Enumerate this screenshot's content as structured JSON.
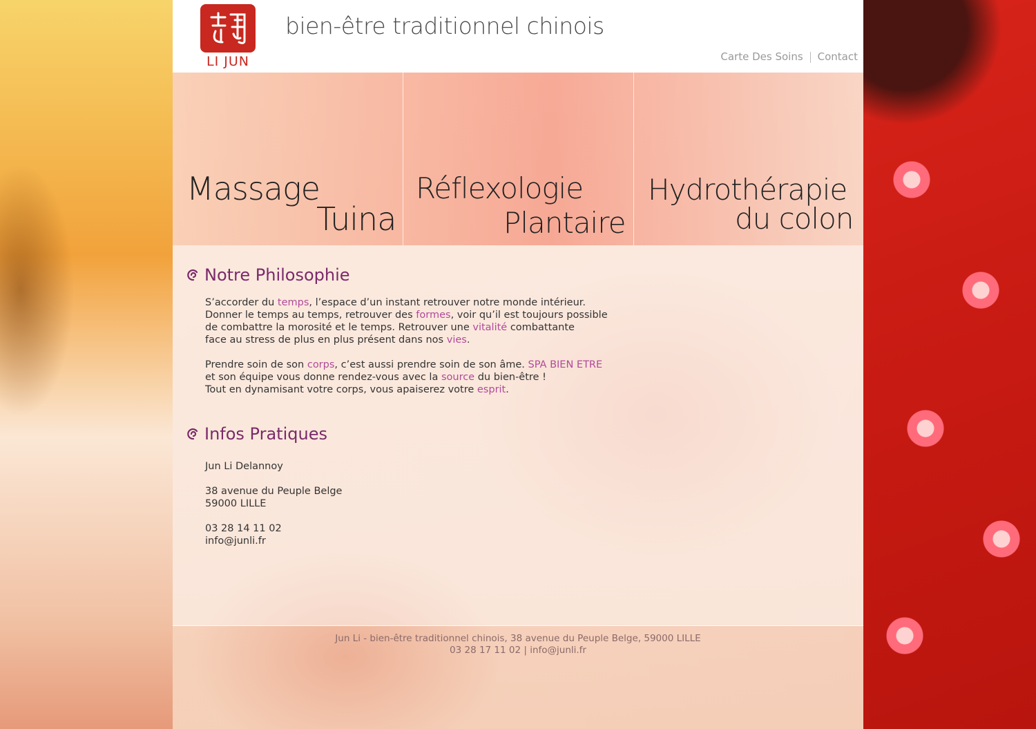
{
  "brand": {
    "logo_text": "LI JUN",
    "tagline": "bien-être traditionnel chinois",
    "accent_color": "#c8281f"
  },
  "topnav": {
    "items": [
      "Carte Des Soins",
      "Contact"
    ]
  },
  "services": [
    {
      "line1": "Massage",
      "line2": "Tuina"
    },
    {
      "line1": "Réflexologie",
      "line2": "Plantaire"
    },
    {
      "line1": "Hydrothérapie",
      "line2": "du colon"
    }
  ],
  "philosophy": {
    "title": "Notre Philosophie",
    "p1": {
      "a": "S’accorder du ",
      "b": "temps",
      "c": ", l’espace d’un instant retrouver notre monde intérieur.",
      "d": "Donner le temps au temps, retrouver des ",
      "e": "formes",
      "f": ", voir qu’il est toujours possible",
      "g": "de combattre la morosité et le temps. Retrouver une ",
      "h": "vitalité",
      "i": " combattante",
      "j": "face au stress de plus en plus présent dans nos ",
      "k": "vies",
      "l": "."
    },
    "p2": {
      "a": "Prendre soin de son ",
      "b": "corps",
      "c": ", c’est aussi prendre soin de son âme. ",
      "d": "SPA BIEN ETRE",
      "e": "et son équipe vous donne rendez-vous avec la ",
      "f": "source",
      "g": " du bien-être !",
      "h": "Tout en dynamisant votre corps, vous apaiserez votre ",
      "i": "esprit",
      "j": "."
    }
  },
  "infos": {
    "title": "Infos Pratiques",
    "name": "Jun Li Delannoy",
    "address1": "38 avenue du Peuple Belge",
    "address2": "59000 LILLE",
    "phone": "03 28 14 11 02",
    "email": "info@junli.fr"
  },
  "footer": {
    "line1": "Jun Li - bien-être traditionnel chinois, 38 avenue du Peuple Belge, 59000 LILLE",
    "line2": "03 28 17 11 02 | info@junli.fr"
  }
}
